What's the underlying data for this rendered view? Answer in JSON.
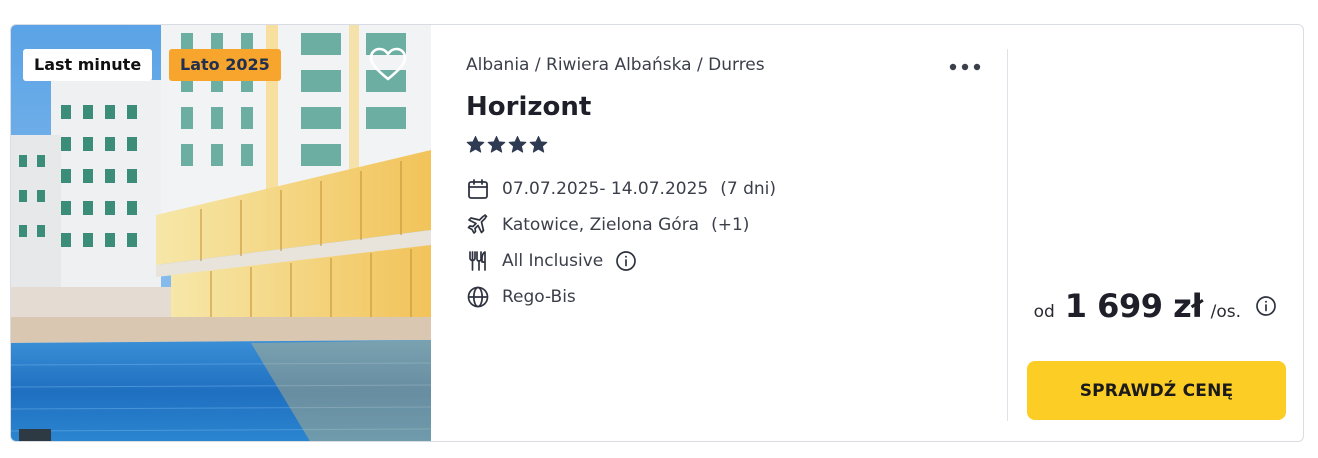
{
  "badges": {
    "last_minute": "Last minute",
    "season": "Lato 2025"
  },
  "hotel": {
    "breadcrumb": "Albania / Riwiera Albańska / Durres",
    "name": "Horizont",
    "stars": 4
  },
  "details": {
    "dates": "07.07.2025- 14.07.2025",
    "duration": "(7 dni)",
    "departure": "Katowice, Zielona Góra",
    "departure_extra": "(+1)",
    "board": "All Inclusive",
    "operator": "Rego-Bis"
  },
  "price": {
    "prefix": "od",
    "amount": "1 699 zł",
    "suffix": "/os."
  },
  "cta": {
    "label": "SPRAWDŹ CENĘ"
  },
  "icons": {
    "favorite": "heart-icon",
    "more": "more-dots-icon",
    "dates": "calendar-icon",
    "departure": "plane-icon",
    "board": "cutlery-icon",
    "operator": "globe-icon",
    "info": "info-icon"
  },
  "colors": {
    "cta": "#fccd25",
    "season_badge": "#f7a52c",
    "stars": "#2f3b52"
  }
}
